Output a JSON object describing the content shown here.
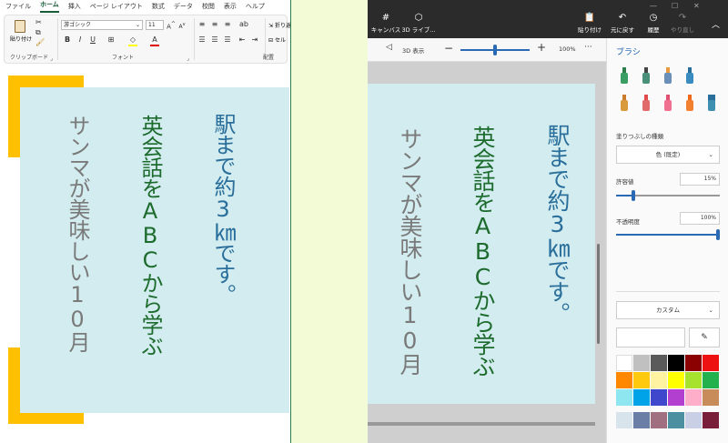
{
  "excel": {
    "tabs": [
      "ファイル",
      "ホーム",
      "挿入",
      "ページ レイアウト",
      "数式",
      "データ",
      "校閲",
      "表示",
      "ヘルプ"
    ],
    "active_tab": "ホーム",
    "paste_label": "貼り付け",
    "clipboard_label": "クリップボード",
    "font_name": "游ゴシック",
    "font_size": "11",
    "font_group_label": "フォント",
    "align_group_label": "配置",
    "wrap_label": "折り返",
    "merge_label": "セル"
  },
  "vertical_text": {
    "col1": "駅まで約3㎞です。",
    "col2": "英会話をABCから学ぶ",
    "col3": "サンマが美味しい10月",
    "colors": {
      "col1": "#2a6f9b",
      "col2": "#1e6b2e",
      "col3": "#7a7a7a"
    }
  },
  "paint": {
    "toolbar": {
      "canvas": "キャンバス",
      "library3d": "3D ライブ...",
      "paste": "貼り付け",
      "undo": "元に戻す",
      "history": "履歴",
      "redo": "やり直し"
    },
    "zoom": {
      "view3d": "3D 表示",
      "percent": "100%",
      "level": 0.5
    },
    "panel": {
      "title": "ブラシ",
      "fill_type_label": "塗りつぶしの種類",
      "fill_type_value": "色 (既定)",
      "tolerance_label": "許容値",
      "tolerance_value": "15%",
      "tolerance_level": 0.15,
      "opacity_label": "不透明度",
      "opacity_value": "100%",
      "opacity_level": 1.0,
      "custom_label": "カスタム",
      "palette": [
        "#ffffff",
        "#c0c0c0",
        "#5a5a5a",
        "#000000",
        "#8b0000",
        "#ee1111",
        "#ff8800",
        "#ffc90e",
        "#fff2a0",
        "#ffff00",
        "#a6e22e",
        "#22b14c",
        "#8ee6f0",
        "#00a2e8",
        "#3f48cc",
        "#b33fd1",
        "#ffaec9",
        "#c88b5a",
        "#d8e4ec",
        "#6b7fa6",
        "#a07080",
        "#4c8fa0",
        "#c9d0e6",
        "#7a1f3a"
      ]
    }
  }
}
